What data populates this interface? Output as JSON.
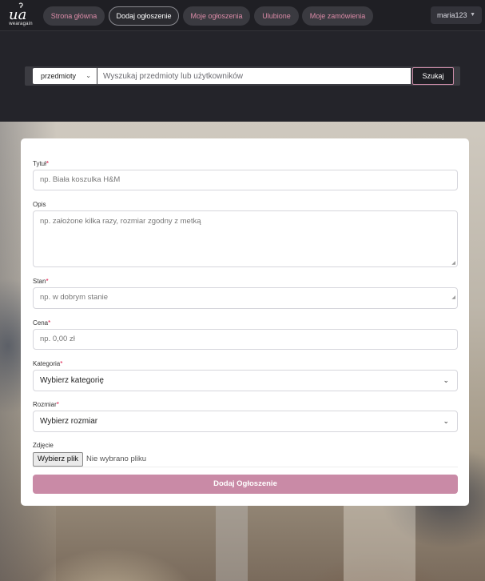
{
  "nav": {
    "logo_text": "wearagain",
    "items": [
      {
        "label": "Strona główna"
      },
      {
        "label": "Dodaj ogłoszenie"
      },
      {
        "label": "Moje ogłoszenia"
      },
      {
        "label": "Ulubione"
      },
      {
        "label": "Moje zamówienia"
      }
    ],
    "active_item": "Dodaj ogłoszenie",
    "user": "maria123",
    "accent_color": "#d98aa6"
  },
  "search": {
    "category_value": "przedmioty",
    "placeholder": "Wyszukaj przedmioty lub użytkowników",
    "button_label": "Szukaj"
  },
  "form": {
    "title_label": "Tytuł",
    "title_placeholder": "np. Biała koszulka H&M",
    "desc_label": "Opis",
    "desc_placeholder": "np. założone kilka razy, rozmiar zgodny z metką",
    "state_label": "Stan",
    "state_placeholder": "np. w dobrym stanie",
    "price_label": "Cena",
    "price_placeholder": "np. 0,00 zł",
    "category_label": "Kategoria",
    "category_value": "Wybierz kategorię",
    "size_label": "Rozmiar",
    "size_value": "Wybierz rozmiar",
    "photo_label": "Zdjęcie",
    "file_button": "Wybierz plik",
    "file_status": "Nie wybrano pliku",
    "submit_label": "Dodaj Ogłoszenie",
    "submit_color": "#c98aa6",
    "required_marker": "*"
  }
}
